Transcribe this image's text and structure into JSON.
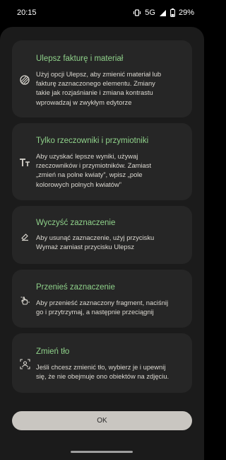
{
  "status_bar": {
    "time": "20:15",
    "network": "5G",
    "battery": "29%"
  },
  "cards": [
    {
      "title": "Ulepsz fakturę i materiał",
      "icon": "texture-icon",
      "lines": [
        "Użyj opcji Ulepsz, aby zmienić materiał lub",
        "fakturę zaznaczonego elementu. Zmiany",
        "takie jak rozjaśnianie i zmiana kontrastu",
        "wprowadzaj w zwykłym edytorze"
      ]
    },
    {
      "title": "Tylko rzeczowniki i przymiotniki",
      "icon": "text-format-icon",
      "lines": [
        "Aby uzyskać lepsze wyniki, używaj",
        "rzeczowników i przymiotników. Zamiast",
        "„zmień na polne kwiaty”, wpisz „pole",
        "kolorowych polnych kwiatów”"
      ]
    },
    {
      "title": "Wyczyść zaznaczenie",
      "icon": "eraser-icon",
      "lines": [
        "Aby usunąć zaznaczenie, użyj przycisku",
        "Wymaż zamiast przycisku Ulepsz"
      ]
    },
    {
      "title": "Przenieś zaznaczenie",
      "icon": "drag-hand-icon",
      "lines": [
        "Aby przenieść zaznaczony fragment, naciśnij",
        "go i przytrzymaj, a następnie przeciągnij"
      ]
    },
    {
      "title": "Zmień tło",
      "icon": "background-replace-icon",
      "lines": [
        "Jeśli chcesz zmienić tło, wybierz je i upewnij",
        "się, że nie obejmuje ono obiektów na zdjęciu."
      ]
    }
  ],
  "ok_button": {
    "label": "OK"
  },
  "colors": {
    "accent": "#8fd18a",
    "sheet": "#1b1b1b",
    "card": "#262626",
    "button": "#c9c6c1"
  }
}
